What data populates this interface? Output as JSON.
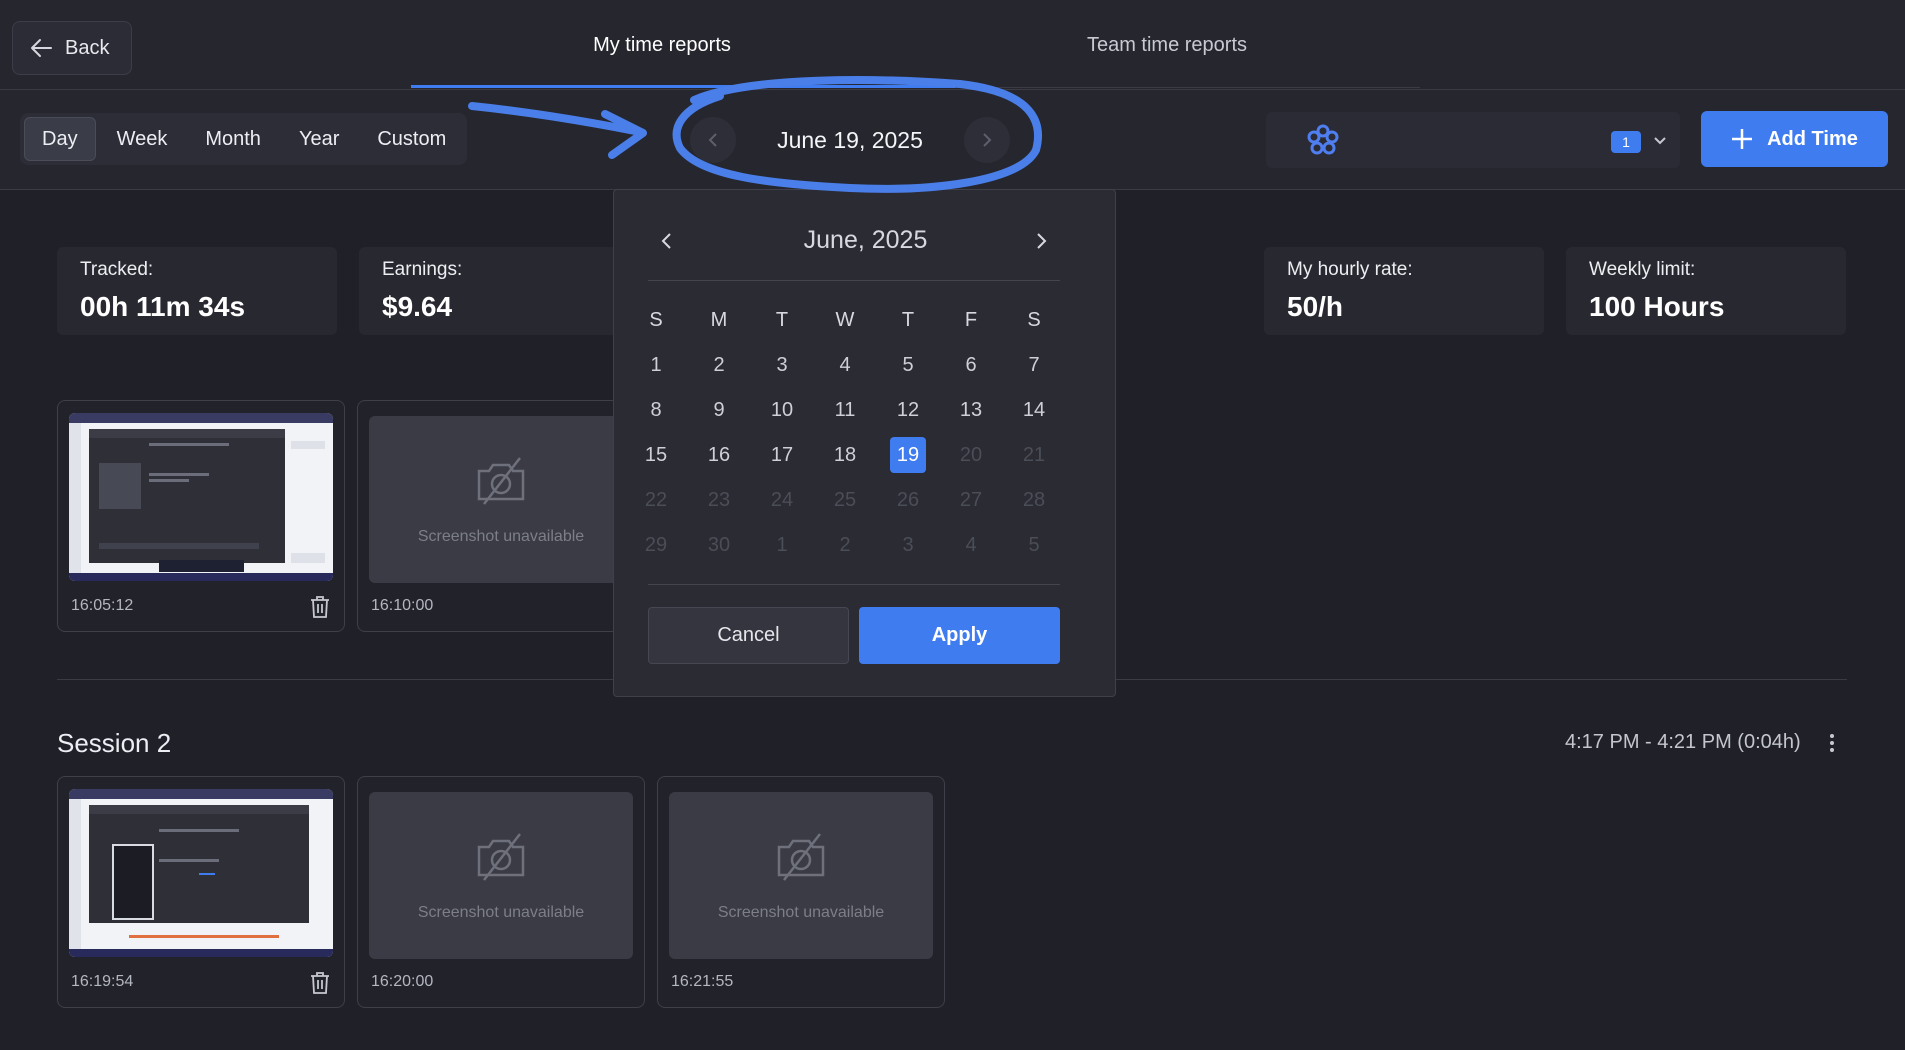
{
  "topbar": {
    "back_label": "Back",
    "tabs": [
      {
        "label": "My time reports",
        "active": true
      },
      {
        "label": "Team time reports",
        "active": false
      }
    ]
  },
  "controls": {
    "periods": [
      {
        "label": "Day",
        "active": true
      },
      {
        "label": "Week",
        "active": false
      },
      {
        "label": "Month",
        "active": false
      },
      {
        "label": "Year",
        "active": false
      },
      {
        "label": "Custom",
        "active": false
      }
    ],
    "date_label": "June 19, 2025",
    "team_select": {
      "badge": "1",
      "icon": "team-flower-icon"
    },
    "add_time_label": "Add Time"
  },
  "stats": [
    {
      "label": "Tracked:",
      "value": "00h 11m 34s"
    },
    {
      "label": "Earnings:",
      "value": "$9.64"
    },
    {
      "label": "My hourly rate:",
      "value": "50/h"
    },
    {
      "label": "Weekly limit:",
      "value": "100 Hours"
    }
  ],
  "session1": {
    "screenshots": [
      {
        "time": "16:05:12",
        "available": true
      },
      {
        "time": "16:10:00",
        "available": false,
        "text": "Screenshot unavailable"
      }
    ]
  },
  "session2": {
    "title": "Session 2",
    "range": "4:17 PM - 4:21 PM (0:04h)",
    "screenshots": [
      {
        "time": "16:19:54",
        "available": true
      },
      {
        "time": "16:20:00",
        "available": false,
        "text": "Screenshot unavailable"
      },
      {
        "time": "16:21:55",
        "available": false,
        "text": "Screenshot unavailable"
      }
    ]
  },
  "calendar": {
    "title": "June, 2025",
    "weekdays": [
      "S",
      "M",
      "T",
      "W",
      "T",
      "F",
      "S"
    ],
    "weeks": [
      [
        "1",
        "2",
        "3",
        "4",
        "5",
        "6",
        "7"
      ],
      [
        "8",
        "9",
        "10",
        "11",
        "12",
        "13",
        "14"
      ],
      [
        "15",
        "16",
        "17",
        "18",
        "19",
        "20",
        "21"
      ],
      [
        "22",
        "23",
        "24",
        "25",
        "26",
        "27",
        "28"
      ],
      [
        "29",
        "30",
        "1",
        "2",
        "3",
        "4",
        "5"
      ]
    ],
    "selected": "19",
    "cancel_label": "Cancel",
    "apply_label": "Apply"
  },
  "colors": {
    "accent": "#3f7cf0",
    "background": "#1f2028",
    "annotation": "#4a7ee8"
  }
}
